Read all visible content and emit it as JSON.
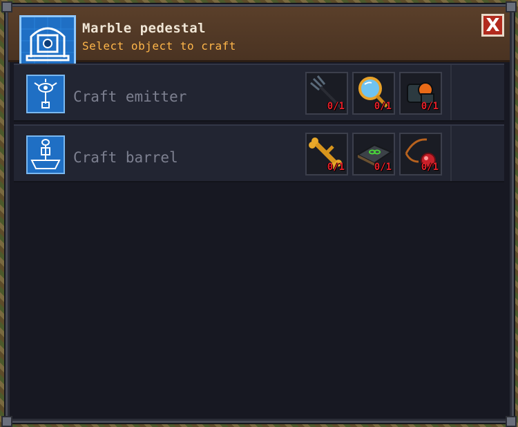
{
  "window": {
    "title": "Marble pedestal",
    "subtitle": "Select object to craft",
    "close_label": "X"
  },
  "recipes": [
    {
      "label": "Craft emitter",
      "icon": "blueprint-emitter-icon",
      "ingredients": [
        {
          "icon": "pitchfork-icon",
          "count": "0/1"
        },
        {
          "icon": "magnifying-glass-icon",
          "count": "0/1"
        },
        {
          "icon": "lens-device-icon",
          "count": "0/1"
        }
      ]
    },
    {
      "label": "Craft barrel",
      "icon": "blueprint-barrel-icon",
      "ingredients": [
        {
          "icon": "golden-bone-icon",
          "count": "0/1"
        },
        {
          "icon": "green-book-icon",
          "count": "0/1"
        },
        {
          "icon": "red-amulet-icon",
          "count": "0/1"
        }
      ]
    }
  ],
  "colors": {
    "header_bg": "#5a3f2a",
    "title": "#f0e6d6",
    "subtitle": "#ffb64a",
    "count_red": "#e8202a",
    "blueprint_blue": "#1f6fc4"
  }
}
